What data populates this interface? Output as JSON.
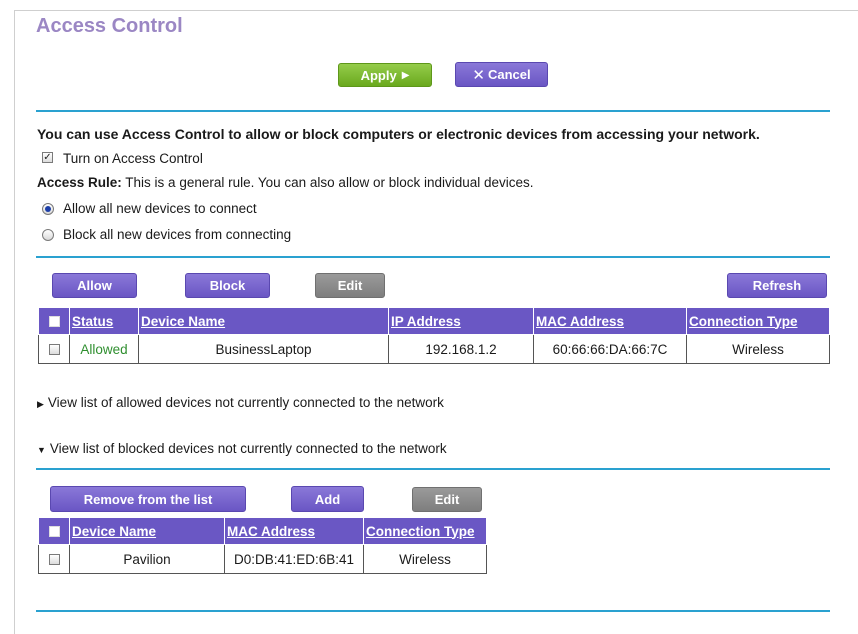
{
  "page": {
    "title": "Access Control",
    "apply_label": "Apply",
    "cancel_label": "Cancel"
  },
  "intro": {
    "text": "You can use Access Control to allow or block computers or electronic devices from accessing your network.",
    "turn_on_label": "Turn on Access Control",
    "turn_on_checked": true,
    "rule_label": "Access Rule:",
    "rule_text": " This is a general rule. You can also allow or block individual devices.",
    "options": [
      {
        "label": "Allow all new devices to connect",
        "selected": true
      },
      {
        "label": "Block all new devices from connecting",
        "selected": false
      }
    ]
  },
  "devices": {
    "buttons": {
      "allow": "Allow",
      "block": "Block",
      "edit": "Edit",
      "refresh": "Refresh"
    },
    "columns": [
      "Status",
      "Device Name",
      "IP Address",
      "MAC Address",
      "Connection Type"
    ],
    "rows": [
      {
        "status": "Allowed",
        "device_name": "BusinessLaptop",
        "ip": "192.168.1.2",
        "mac": "60:66:66:DA:66:7C",
        "connection": "Wireless"
      }
    ]
  },
  "toggles": {
    "allowed_list": "View list of allowed devices not currently connected to the network",
    "blocked_list": "View list of blocked devices not currently connected to the network"
  },
  "blocked": {
    "buttons": {
      "remove": "Remove from the list",
      "add": "Add",
      "edit": "Edit"
    },
    "columns": [
      "Device Name",
      "MAC Address",
      "Connection Type"
    ],
    "rows": [
      {
        "device_name": "Pavilion",
        "mac": "D0:DB:41:ED:6B:41",
        "connection": "Wireless"
      }
    ]
  }
}
